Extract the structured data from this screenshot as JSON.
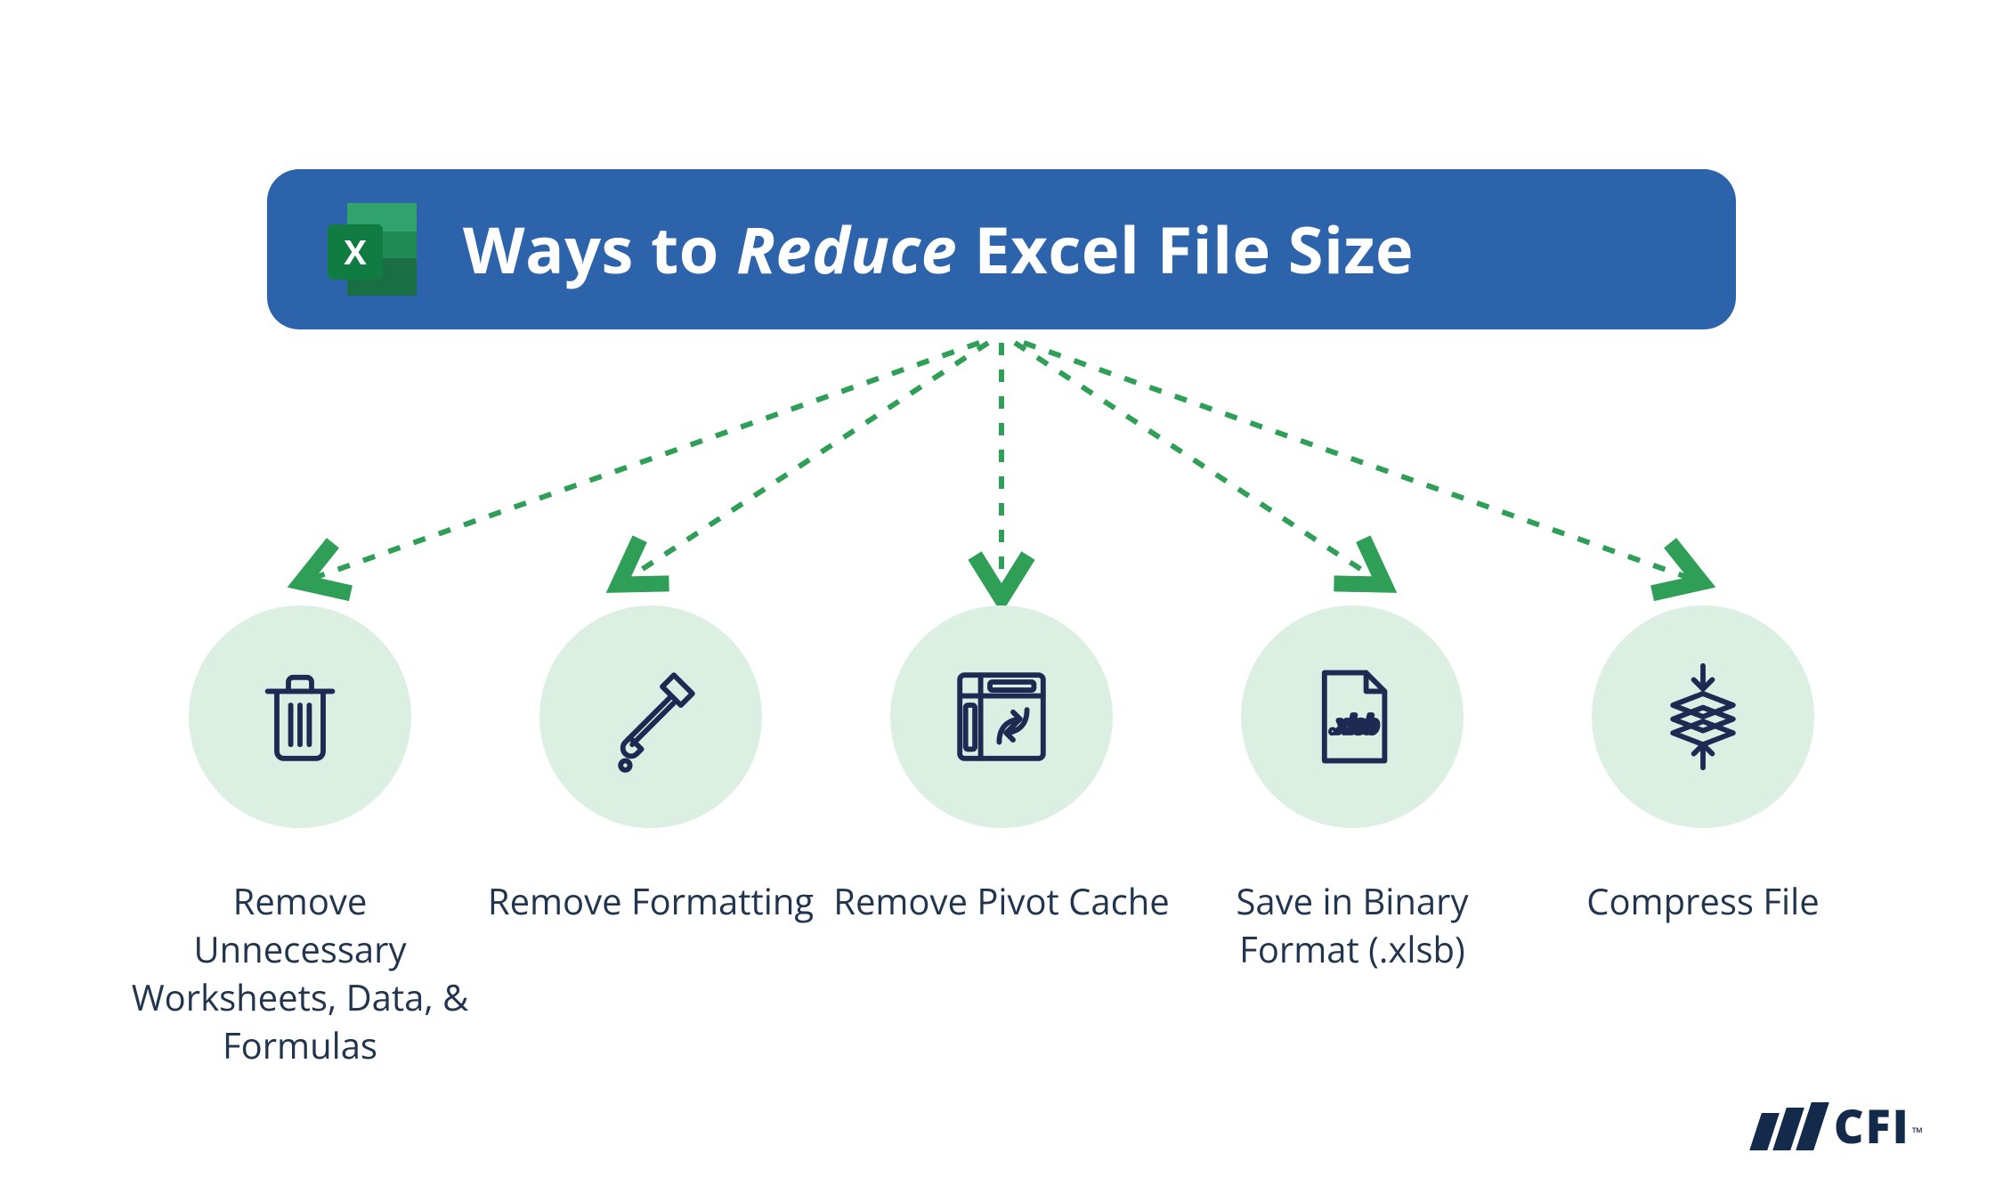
{
  "header": {
    "title_prefix": "Ways to ",
    "title_emphasis": "Reduce",
    "title_suffix": " Excel File Size",
    "icon_letter": "X"
  },
  "items": [
    {
      "label": "Remove Unnecessary Worksheets, Data, & Formulas",
      "icon": "trash"
    },
    {
      "label": "Remove Formatting",
      "icon": "eyedropper"
    },
    {
      "label": "Remove Pivot Cache",
      "icon": "pivot"
    },
    {
      "label": "Save in Binary Format (.xlsb)",
      "icon": "xlsb",
      "badge": ".xlsb"
    },
    {
      "label": "Compress File",
      "icon": "compress"
    }
  ],
  "brand": {
    "name": "CFI",
    "trademark": "™"
  },
  "colors": {
    "header_bg": "#2c63aa",
    "circle_bg": "#dcefe3",
    "icon_stroke": "#1e2a52",
    "arrow": "#2f9e57",
    "text": "#22354e"
  }
}
